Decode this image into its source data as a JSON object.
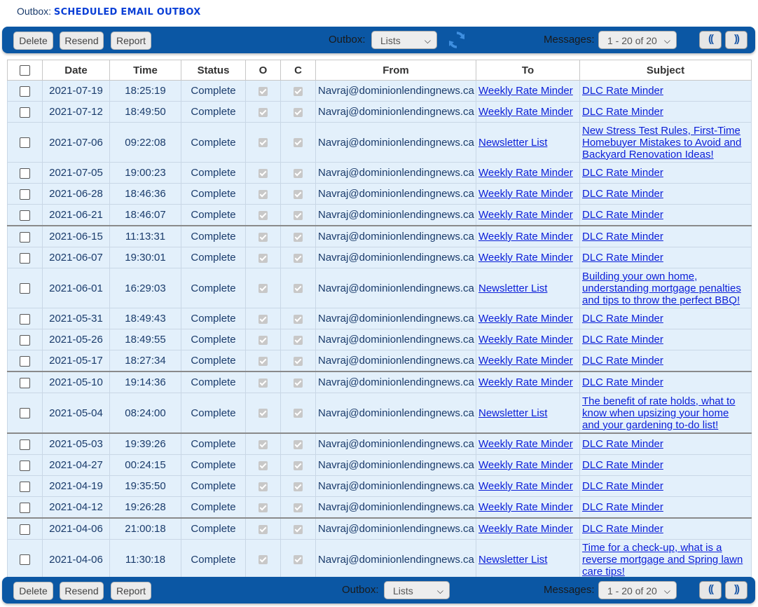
{
  "header": {
    "label": "Outbox:",
    "title": "SCHEDULED EMAIL OUTBOX"
  },
  "toolbar": {
    "delete_label": "Delete",
    "resend_label": "Resend",
    "report_label": "Report",
    "outbox_label": "Outbox:",
    "outbox_value": "Lists",
    "messages_label": "Messages:",
    "messages_value": "1 - 20 of 20",
    "prev_label": "((",
    "next_label": "))"
  },
  "columns": [
    "Date",
    "Time",
    "Status",
    "O",
    "C",
    "From",
    "To",
    "Subject"
  ],
  "rows": [
    {
      "date": "2021-07-19",
      "time": "18:25:19",
      "status": "Complete",
      "from": "Navraj@dominionlendingnews.ca",
      "to": "Weekly Rate Minder",
      "subject": "DLC Rate Minder"
    },
    {
      "date": "2021-07-12",
      "time": "18:49:50",
      "status": "Complete",
      "from": "Navraj@dominionlendingnews.ca",
      "to": "Weekly Rate Minder",
      "subject": "DLC Rate Minder"
    },
    {
      "date": "2021-07-06",
      "time": "09:22:08",
      "status": "Complete",
      "from": "Navraj@dominionlendingnews.ca",
      "to": "Newsletter List",
      "subject": "New Stress Test Rules, First-Time Homebuyer Mistakes to Avoid and Backyard Renovation Ideas!"
    },
    {
      "date": "2021-07-05",
      "time": "19:00:23",
      "status": "Complete",
      "from": "Navraj@dominionlendingnews.ca",
      "to": "Weekly Rate Minder",
      "subject": "DLC Rate Minder"
    },
    {
      "date": "2021-06-28",
      "time": "18:46:36",
      "status": "Complete",
      "from": "Navraj@dominionlendingnews.ca",
      "to": "Weekly Rate Minder",
      "subject": "DLC Rate Minder"
    },
    {
      "date": "2021-06-21",
      "time": "18:46:07",
      "status": "Complete",
      "from": "Navraj@dominionlendingnews.ca",
      "to": "Weekly Rate Minder",
      "subject": "DLC Rate Minder"
    },
    {
      "date": "2021-06-15",
      "time": "11:13:31",
      "status": "Complete",
      "from": "Navraj@dominionlendingnews.ca",
      "to": "Weekly Rate Minder",
      "subject": "DLC Rate Minder"
    },
    {
      "date": "2021-06-07",
      "time": "19:30:01",
      "status": "Complete",
      "from": "Navraj@dominionlendingnews.ca",
      "to": "Weekly Rate Minder",
      "subject": "DLC Rate Minder"
    },
    {
      "date": "2021-06-01",
      "time": "16:29:03",
      "status": "Complete",
      "from": "Navraj@dominionlendingnews.ca",
      "to": "Newsletter List",
      "subject": "Building your own home, understanding mortgage penalties and tips to throw the perfect BBQ!"
    },
    {
      "date": "2021-05-31",
      "time": "18:49:43",
      "status": "Complete",
      "from": "Navraj@dominionlendingnews.ca",
      "to": "Weekly Rate Minder",
      "subject": "DLC Rate Minder"
    },
    {
      "date": "2021-05-26",
      "time": "18:49:55",
      "status": "Complete",
      "from": "Navraj@dominionlendingnews.ca",
      "to": "Weekly Rate Minder",
      "subject": "DLC Rate Minder"
    },
    {
      "date": "2021-05-17",
      "time": "18:27:34",
      "status": "Complete",
      "from": "Navraj@dominionlendingnews.ca",
      "to": "Weekly Rate Minder",
      "subject": "DLC Rate Minder"
    },
    {
      "date": "2021-05-10",
      "time": "19:14:36",
      "status": "Complete",
      "from": "Navraj@dominionlendingnews.ca",
      "to": "Weekly Rate Minder",
      "subject": "DLC Rate Minder"
    },
    {
      "date": "2021-05-04",
      "time": "08:24:00",
      "status": "Complete",
      "from": "Navraj@dominionlendingnews.ca",
      "to": "Newsletter List",
      "subject": "The benefit of rate holds, what to know when upsizing your home and your gardening to-do list!"
    },
    {
      "date": "2021-05-03",
      "time": "19:39:26",
      "status": "Complete",
      "from": "Navraj@dominionlendingnews.ca",
      "to": "Weekly Rate Minder",
      "subject": "DLC Rate Minder"
    },
    {
      "date": "2021-04-27",
      "time": "00:24:15",
      "status": "Complete",
      "from": "Navraj@dominionlendingnews.ca",
      "to": "Weekly Rate Minder",
      "subject": "DLC Rate Minder"
    },
    {
      "date": "2021-04-19",
      "time": "19:35:50",
      "status": "Complete",
      "from": "Navraj@dominionlendingnews.ca",
      "to": "Weekly Rate Minder",
      "subject": "DLC Rate Minder"
    },
    {
      "date": "2021-04-12",
      "time": "19:26:28",
      "status": "Complete",
      "from": "Navraj@dominionlendingnews.ca",
      "to": "Weekly Rate Minder",
      "subject": "DLC Rate Minder"
    },
    {
      "date": "2021-04-06",
      "time": "21:00:18",
      "status": "Complete",
      "from": "Navraj@dominionlendingnews.ca",
      "to": "Weekly Rate Minder",
      "subject": "DLC Rate Minder"
    },
    {
      "date": "2021-04-06",
      "time": "11:30:18",
      "status": "Complete",
      "from": "Navraj@dominionlendingnews.ca",
      "to": "Newsletter List",
      "subject": "Time for a check-up, what is a reverse mortgage and Spring lawn care tips!"
    }
  ]
}
